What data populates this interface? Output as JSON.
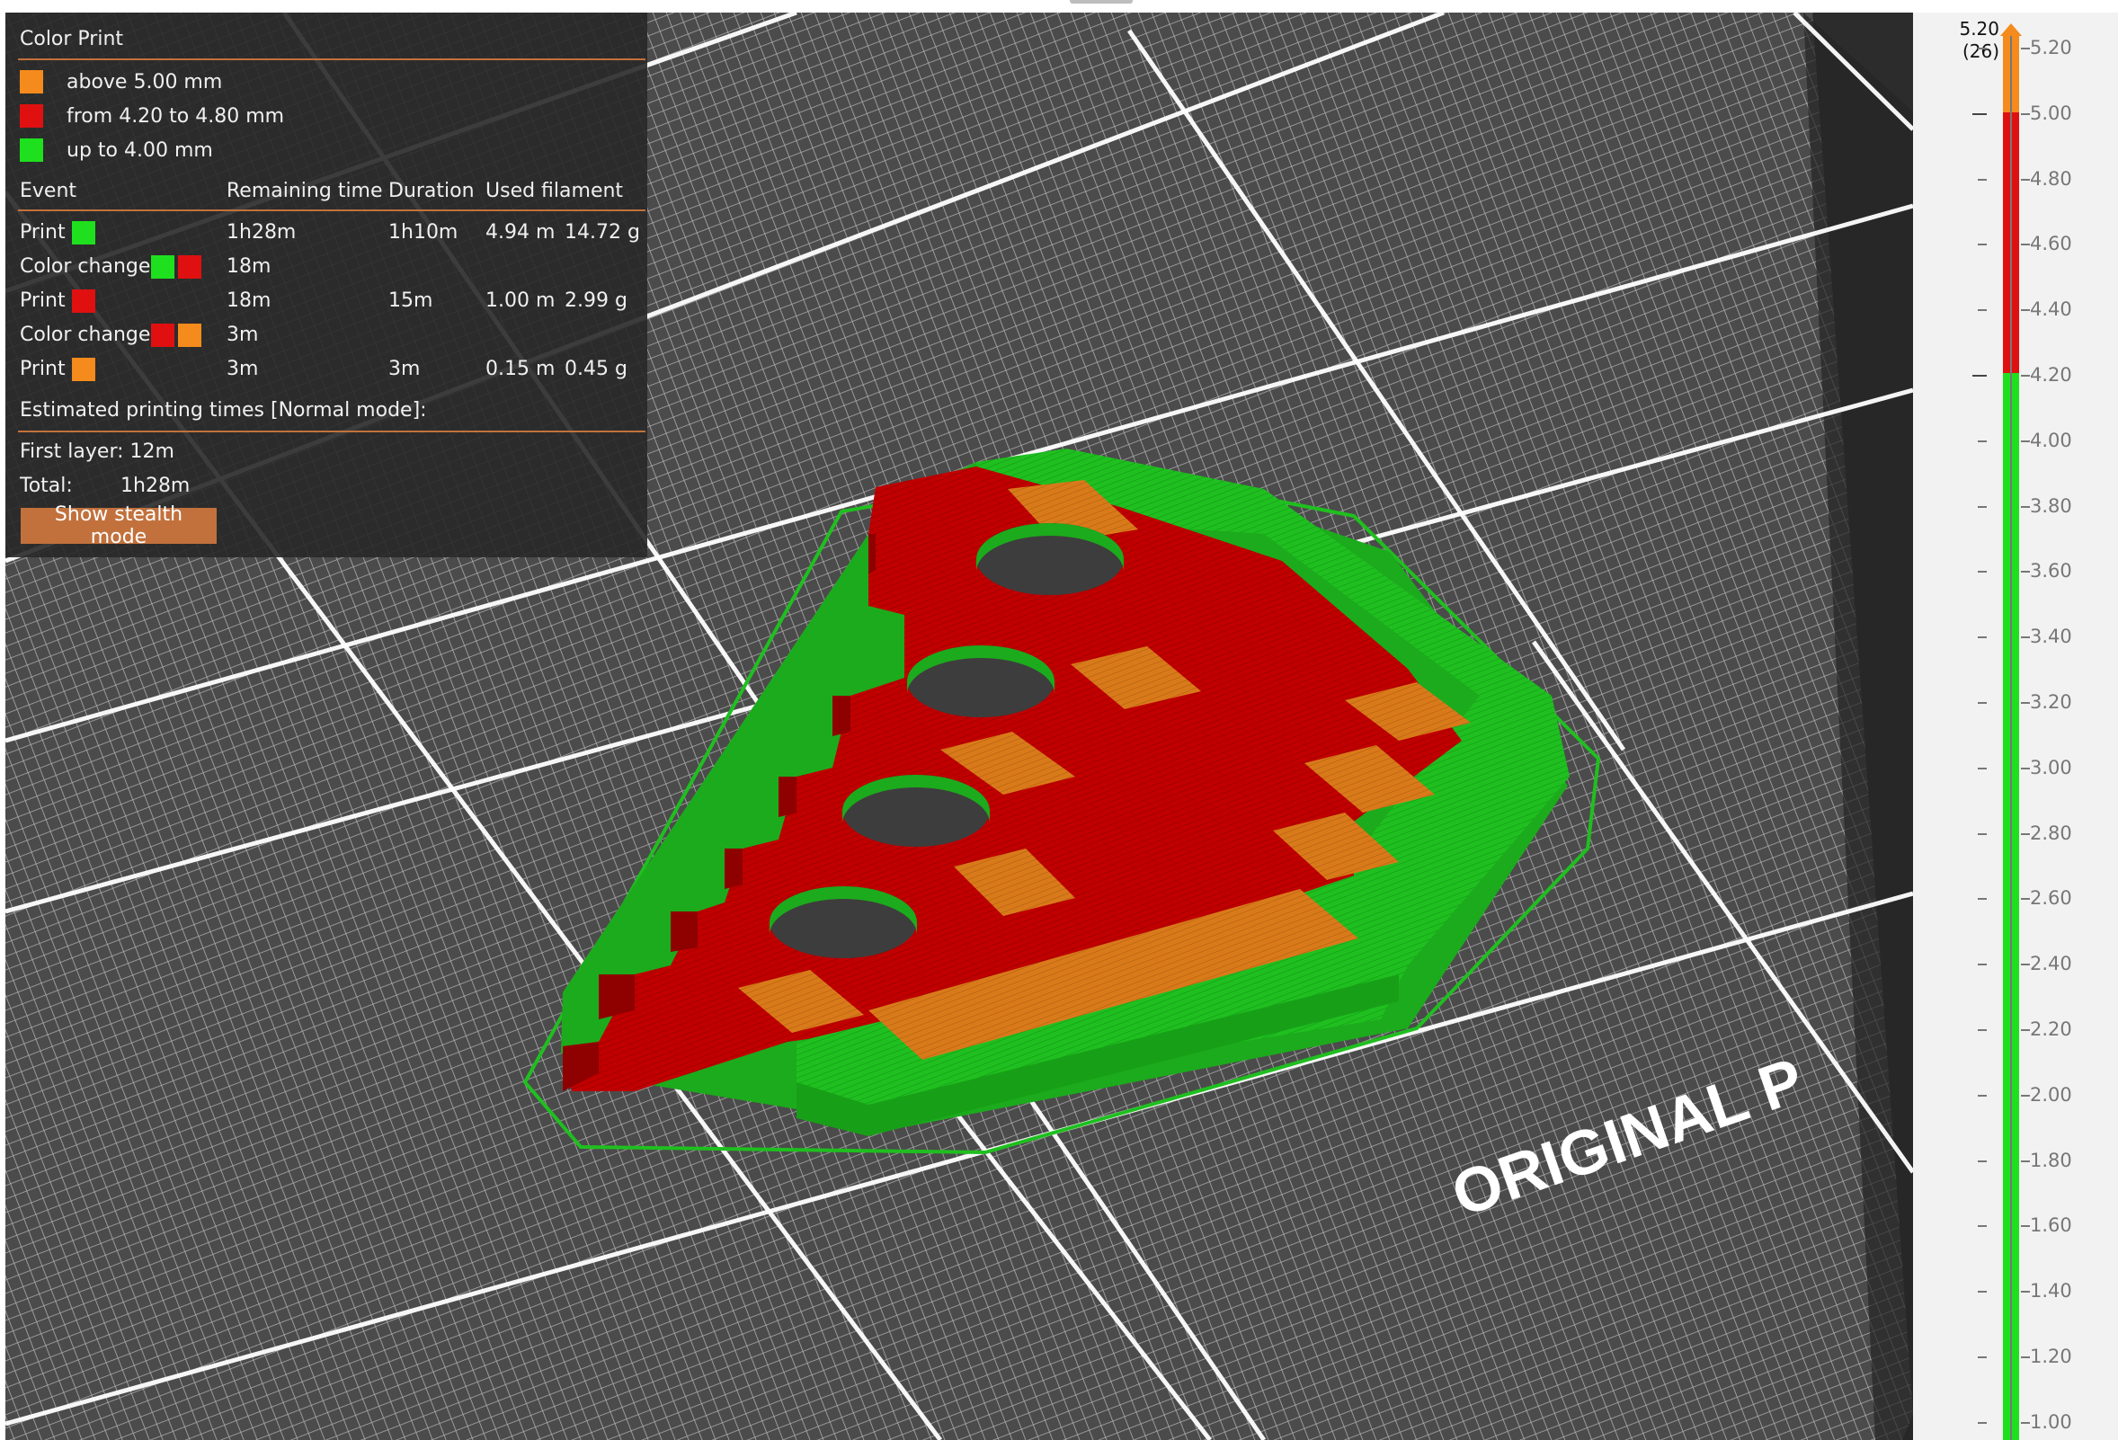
{
  "colors": {
    "orange": "#f48b1c",
    "red": "#e01010",
    "green": "#1ee01e",
    "accent": "#c2713c",
    "bed": "#4a4a4a"
  },
  "legend": {
    "title": "Color Print",
    "ranges": [
      {
        "label": "above 5.00 mm",
        "color": "#f48b1c"
      },
      {
        "label": "from 4.20 to 4.80 mm",
        "color": "#e01010"
      },
      {
        "label": "up to 4.00 mm",
        "color": "#1ee01e"
      }
    ],
    "headers": {
      "event": "Event",
      "remaining": "Remaining time",
      "duration": "Duration",
      "filament": "Used filament"
    },
    "events": [
      {
        "event": "Print",
        "colors": [
          "#1ee01e"
        ],
        "remaining": "1h28m",
        "duration": "1h10m",
        "length": "4.94 m",
        "weight": "14.72 g"
      },
      {
        "event": "Color change",
        "colors": [
          "#1ee01e",
          "#e01010"
        ],
        "remaining": "18m",
        "duration": "",
        "length": "",
        "weight": ""
      },
      {
        "event": "Print",
        "colors": [
          "#e01010"
        ],
        "remaining": "18m",
        "duration": "15m",
        "length": "1.00 m",
        "weight": "2.99 g"
      },
      {
        "event": "Color change",
        "colors": [
          "#e01010",
          "#f48b1c"
        ],
        "remaining": "3m",
        "duration": "",
        "length": "",
        "weight": ""
      },
      {
        "event": "Print",
        "colors": [
          "#f48b1c"
        ],
        "remaining": "3m",
        "duration": "3m",
        "length": "0.15 m",
        "weight": "0.45 g"
      }
    ],
    "estimated_label": "Estimated printing times [Normal mode]:",
    "first_layer": "First layer: 12m",
    "total_label": "Total:",
    "total_value": "1h28m",
    "stealth_button": "Show stealth mode"
  },
  "bed": {
    "label": "ORIGINAL P"
  },
  "slider": {
    "top_value": "5.20",
    "top_layer": "(26)",
    "ticks": [
      "5.20",
      "5.00",
      "4.80",
      "4.60",
      "4.40",
      "4.20",
      "4.00",
      "3.80",
      "3.60",
      "3.40",
      "3.20",
      "3.00",
      "2.80",
      "2.60",
      "2.40",
      "2.20",
      "2.00",
      "1.80",
      "1.60",
      "1.40",
      "1.20",
      "1.00"
    ],
    "change_points": [
      "5.00",
      "4.20"
    ]
  }
}
